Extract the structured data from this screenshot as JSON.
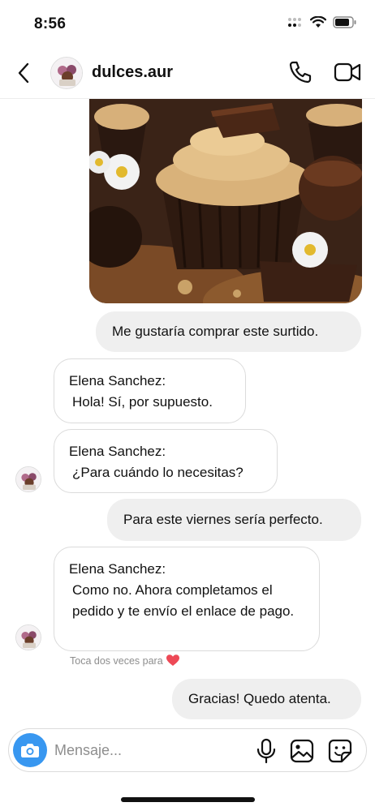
{
  "status_bar": {
    "time": "8:56"
  },
  "header": {
    "username": "dulces.aur"
  },
  "messages": [
    {
      "from": "me",
      "text": "Me gustaría comprar este surtido."
    },
    {
      "from": "them",
      "sender": "Elena Sanchez:",
      "text": "Hola! Sí, por supuesto."
    },
    {
      "from": "them",
      "sender": "Elena Sanchez:",
      "text": "¿Para cuándo lo necesitas?"
    },
    {
      "from": "me",
      "text": "Para este viernes sería perfecto."
    },
    {
      "from": "them",
      "sender": "Elena Sanchez:",
      "text": "Como no. Ahora completamos el pedido y te envío el enlace de pago."
    },
    {
      "from": "me",
      "text": "Gracias! Quedo atenta."
    }
  ],
  "like_hint": "Toca dos veces para",
  "composer": {
    "placeholder": "Mensaje..."
  },
  "colors": {
    "accent": "#3897f0",
    "heart": "#ed4956",
    "bubble_out": "#efefef"
  },
  "icons": [
    "signal-icon",
    "wifi-icon",
    "battery-icon",
    "back-icon",
    "phone-icon",
    "video-icon",
    "camera-icon",
    "microphone-icon",
    "gallery-icon",
    "sticker-icon",
    "heart-icon"
  ]
}
